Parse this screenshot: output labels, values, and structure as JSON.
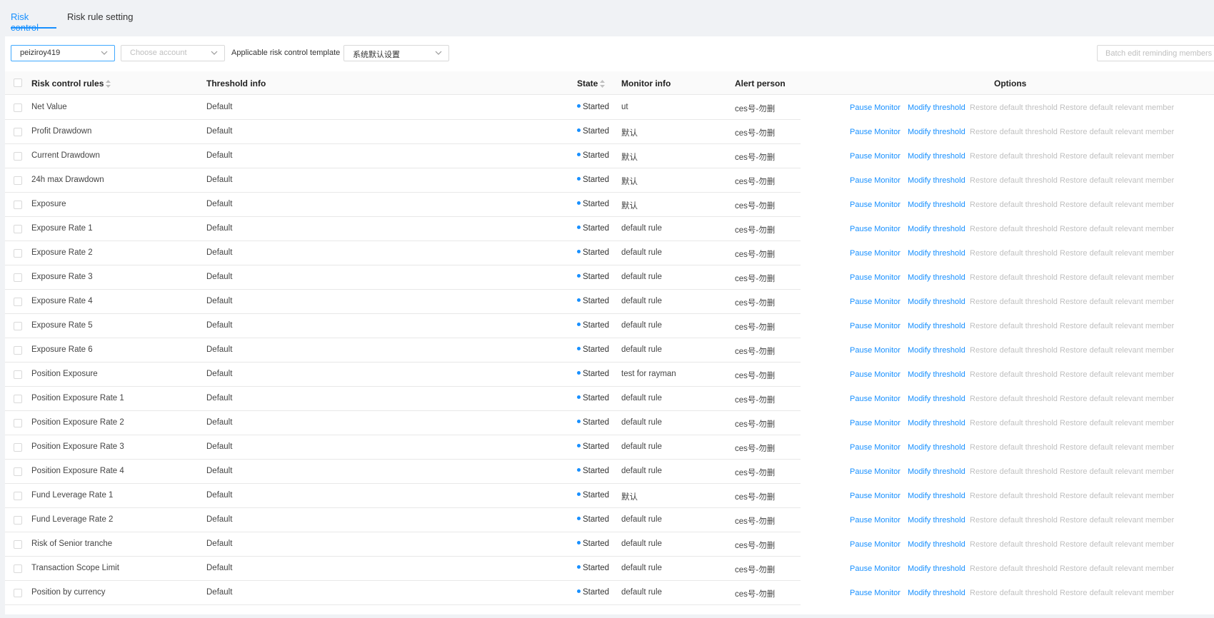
{
  "tabs": [
    {
      "label": "Risk control",
      "active": true
    },
    {
      "label": "Risk rule setting",
      "active": false
    }
  ],
  "filters": {
    "account_group": "peiziroy419",
    "account_placeholder": "Choose account",
    "template_label": "Applicable risk control template",
    "template_value": "系统默认设置"
  },
  "batch_button": "Batch edit reminding members",
  "columns": {
    "rule": "Risk control rules",
    "threshold": "Threshold info",
    "state": "State",
    "monitor": "Monitor info",
    "alert": "Alert person",
    "options": "Options"
  },
  "actions": {
    "pause": "Pause Monitor",
    "modify": "Modify threshold",
    "restore_threshold": "Restore default threshold",
    "restore_member": "Restore default relevant member"
  },
  "colors": {
    "accent": "#1890ff",
    "disabled": "#bfbfbf"
  },
  "rows": [
    {
      "rule": "Net Value",
      "threshold": "Default",
      "state": "Started",
      "monitor": "ut",
      "alert": "ces号-勿删"
    },
    {
      "rule": "Profit Drawdown",
      "threshold": "Default",
      "state": "Started",
      "monitor": "默认",
      "alert": "ces号-勿删"
    },
    {
      "rule": "Current Drawdown",
      "threshold": "Default",
      "state": "Started",
      "monitor": "默认",
      "alert": "ces号-勿删"
    },
    {
      "rule": "24h max Drawdown",
      "threshold": "Default",
      "state": "Started",
      "monitor": "默认",
      "alert": "ces号-勿删"
    },
    {
      "rule": "Exposure",
      "threshold": "Default",
      "state": "Started",
      "monitor": "默认",
      "alert": "ces号-勿删"
    },
    {
      "rule": "Exposure Rate 1",
      "threshold": "Default",
      "state": "Started",
      "monitor": "default rule",
      "alert": "ces号-勿删"
    },
    {
      "rule": "Exposure Rate 2",
      "threshold": "Default",
      "state": "Started",
      "monitor": "default rule",
      "alert": "ces号-勿删"
    },
    {
      "rule": "Exposure Rate 3",
      "threshold": "Default",
      "state": "Started",
      "monitor": "default rule",
      "alert": "ces号-勿删"
    },
    {
      "rule": "Exposure Rate 4",
      "threshold": "Default",
      "state": "Started",
      "monitor": "default rule",
      "alert": "ces号-勿删"
    },
    {
      "rule": "Exposure Rate 5",
      "threshold": "Default",
      "state": "Started",
      "monitor": "default rule",
      "alert": "ces号-勿删"
    },
    {
      "rule": "Exposure Rate 6",
      "threshold": "Default",
      "state": "Started",
      "monitor": "default rule",
      "alert": "ces号-勿删"
    },
    {
      "rule": "Position Exposure",
      "threshold": "Default",
      "state": "Started",
      "monitor": "test for rayman",
      "alert": "ces号-勿删"
    },
    {
      "rule": "Position Exposure Rate 1",
      "threshold": "Default",
      "state": "Started",
      "monitor": "default rule",
      "alert": "ces号-勿删"
    },
    {
      "rule": "Position Exposure Rate 2",
      "threshold": "Default",
      "state": "Started",
      "monitor": "default rule",
      "alert": "ces号-勿删"
    },
    {
      "rule": "Position Exposure Rate 3",
      "threshold": "Default",
      "state": "Started",
      "monitor": "default rule",
      "alert": "ces号-勿删"
    },
    {
      "rule": "Position Exposure Rate 4",
      "threshold": "Default",
      "state": "Started",
      "monitor": "default rule",
      "alert": "ces号-勿删"
    },
    {
      "rule": "Fund Leverage Rate 1",
      "threshold": "Default",
      "state": "Started",
      "monitor": "默认",
      "alert": "ces号-勿删"
    },
    {
      "rule": "Fund Leverage Rate 2",
      "threshold": "Default",
      "state": "Started",
      "monitor": "default rule",
      "alert": "ces号-勿删"
    },
    {
      "rule": "Risk of Senior tranche",
      "threshold": "Default",
      "state": "Started",
      "monitor": "default rule",
      "alert": "ces号-勿删"
    },
    {
      "rule": "Transaction Scope Limit",
      "threshold": "Default",
      "state": "Started",
      "monitor": "default rule",
      "alert": "ces号-勿删"
    },
    {
      "rule": "Position by currency",
      "threshold": "Default",
      "state": "Started",
      "monitor": "default rule",
      "alert": "ces号-勿删"
    }
  ]
}
